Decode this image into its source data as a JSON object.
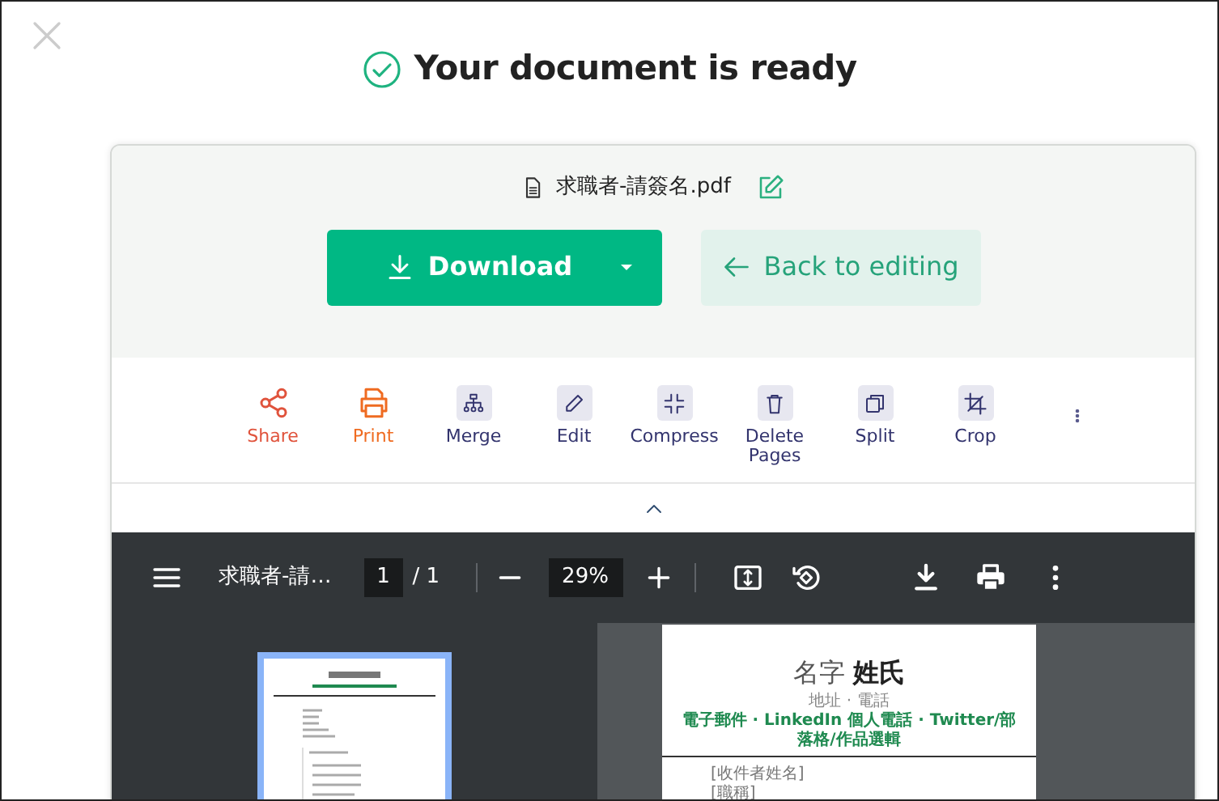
{
  "heading": "Your document is ready",
  "file": {
    "name": "求職者-請簽名.pdf"
  },
  "buttons": {
    "download": "Download",
    "back": "Back to editing"
  },
  "tools": [
    {
      "label": "Share",
      "kind": "share",
      "color": "#e0533c"
    },
    {
      "label": "Print",
      "kind": "print",
      "color": "#ef6b21"
    },
    {
      "label": "Merge",
      "kind": "merge",
      "color": "#33346e"
    },
    {
      "label": "Edit",
      "kind": "edit",
      "color": "#33346e"
    },
    {
      "label": "Compress",
      "kind": "compress",
      "color": "#33346e"
    },
    {
      "label": "Delete Pages",
      "kind": "delete",
      "color": "#33346e"
    },
    {
      "label": "Split",
      "kind": "split",
      "color": "#33346e"
    },
    {
      "label": "Crop",
      "kind": "crop",
      "color": "#33346e"
    }
  ],
  "viewer": {
    "title": "求職者-請…",
    "page": "1",
    "total": "/ 1",
    "zoom": "29%"
  },
  "document": {
    "name_first": "名字",
    "name_last": "姓氏",
    "subtitle": "地址 · 電話",
    "contacts": "電子郵件 · LinkedIn 個人電話 · Twitter/部落格/作品選輯",
    "lines": [
      "[收件者姓名]",
      "[職稱]"
    ]
  }
}
